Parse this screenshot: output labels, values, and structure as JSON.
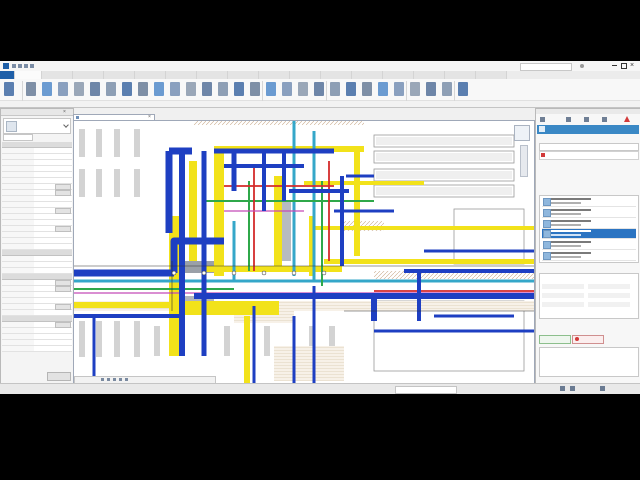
{
  "window": {
    "title": ""
  },
  "ribbon": {
    "tabs": [
      {
        "label": "",
        "state": "file"
      },
      {
        "label": "",
        "state": "selected"
      },
      {
        "label": "",
        "state": ""
      },
      {
        "label": "",
        "state": ""
      },
      {
        "label": "",
        "state": ""
      },
      {
        "label": "",
        "state": ""
      },
      {
        "label": "",
        "state": ""
      },
      {
        "label": "",
        "state": ""
      },
      {
        "label": "",
        "state": ""
      },
      {
        "label": "",
        "state": ""
      },
      {
        "label": "",
        "state": ""
      },
      {
        "label": "",
        "state": ""
      },
      {
        "label": "",
        "state": ""
      },
      {
        "label": "",
        "state": ""
      },
      {
        "label": "",
        "state": ""
      },
      {
        "label": "",
        "state": ""
      },
      {
        "label": "",
        "state": ""
      }
    ],
    "tool_icons": [
      "modify-icon",
      "wall-icon",
      "door-icon",
      "window-icon",
      "component-icon",
      "column-icon",
      "roof-icon",
      "ceiling-icon",
      "floor-icon",
      "curtain-icon",
      "mullion-icon",
      "railing-icon",
      "ramp-icon",
      "stair-icon",
      "model-text-icon",
      "model-line-icon",
      "model-group-icon",
      "room-icon",
      "room-separator-icon",
      "area-icon",
      "tag-icon",
      "face-icon",
      "shaft-icon",
      "opening-icon",
      "level-icon",
      "grid-icon",
      "set-icon",
      "show-icon",
      "viewer-icon"
    ]
  },
  "properties_panel": {
    "title": "",
    "type_selector": "",
    "view_selector": "",
    "edit_type_label": "",
    "groups": [
      {
        "label": "",
        "rows": [
          {
            "label": "",
            "value": ""
          },
          {
            "label": "",
            "value": ""
          },
          {
            "label": "",
            "value": ""
          },
          {
            "label": "",
            "value": ""
          },
          {
            "label": "",
            "value": ""
          },
          {
            "label": "",
            "value": ""
          },
          {
            "label": "",
            "value": "",
            "button": true
          },
          {
            "label": "",
            "value": "",
            "button": true
          },
          {
            "label": "",
            "value": ""
          },
          {
            "label": "",
            "value": ""
          },
          {
            "label": "",
            "value": "",
            "button": true
          },
          {
            "label": "",
            "value": ""
          },
          {
            "label": "",
            "value": ""
          },
          {
            "label": "",
            "value": "",
            "button": true
          },
          {
            "label": "",
            "value": ""
          },
          {
            "label": "",
            "value": ""
          },
          {
            "label": "",
            "value": ""
          }
        ]
      },
      {
        "label": "",
        "rows": [
          {
            "label": "",
            "value": ""
          },
          {
            "label": "",
            "value": ""
          },
          {
            "label": "",
            "value": ""
          }
        ]
      },
      {
        "label": "",
        "rows": [
          {
            "label": "",
            "value": "",
            "button": true
          },
          {
            "label": "",
            "value": "",
            "button": true
          },
          {
            "label": "",
            "value": ""
          },
          {
            "label": "",
            "value": ""
          },
          {
            "label": "",
            "value": "",
            "button": true
          },
          {
            "label": "",
            "value": ""
          }
        ]
      },
      {
        "label": "",
        "rows": [
          {
            "label": "",
            "value": "",
            "button": true
          },
          {
            "label": "",
            "value": ""
          },
          {
            "label": "",
            "value": ""
          },
          {
            "label": "",
            "value": ""
          },
          {
            "label": "",
            "value": ""
          }
        ]
      }
    ],
    "footer_link": "",
    "apply_button": ""
  },
  "view": {
    "tab_label": "",
    "scale_label": "",
    "colors": {
      "blue_duct": "#1e3fc2",
      "cyan_pipe": "#35a7c9",
      "yellow_cabletray": "#f2e21a",
      "red_pipe": "#d42a2a",
      "green_pipe": "#2fa84a",
      "gray_equipment": "#9aa0a8",
      "wall_hatch": "#c9a98a",
      "magenta_line": "#c44ab8"
    }
  },
  "right_panel": {
    "header_title": "",
    "themes_label": "",
    "selected_theme": "",
    "reports_label": "",
    "reports": [
      {
        "name": "",
        "sub": "",
        "selected": false
      },
      {
        "name": "",
        "sub": "",
        "selected": false
      },
      {
        "name": "",
        "sub": "",
        "selected": false
      },
      {
        "name": "",
        "sub": "",
        "selected": true
      },
      {
        "name": "",
        "sub": "",
        "selected": false
      },
      {
        "name": "",
        "sub": "",
        "selected": false
      }
    ],
    "report_section_label": "",
    "report_title": "",
    "report_fields": [
      "",
      "",
      "",
      "",
      "",
      ""
    ],
    "workflow_label": "",
    "accept_button": "",
    "reject_button": "",
    "accent": "#3a88c5"
  },
  "status_bar": {
    "text": "",
    "search_placeholder": ""
  }
}
